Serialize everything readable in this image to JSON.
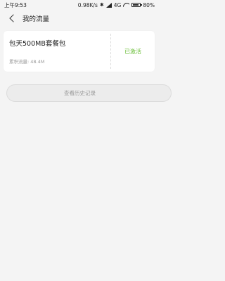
{
  "status_bar": {
    "time": "上午9:53",
    "net_speed": "0.98K/s",
    "network_type": "4G",
    "battery": "80%",
    "battery_level": 0.8
  },
  "header": {
    "title": "我的流量"
  },
  "package": {
    "name": "包天500MB套餐包",
    "usage_label": "累积流量: 48.4M",
    "status": "已激活",
    "status_color": "#6cbf3a"
  },
  "history_button": {
    "label": "查看历史记录"
  },
  "icons": [
    "back-icon",
    "bluetooth-icon",
    "signal-icon",
    "wifi-icon",
    "battery-icon"
  ]
}
